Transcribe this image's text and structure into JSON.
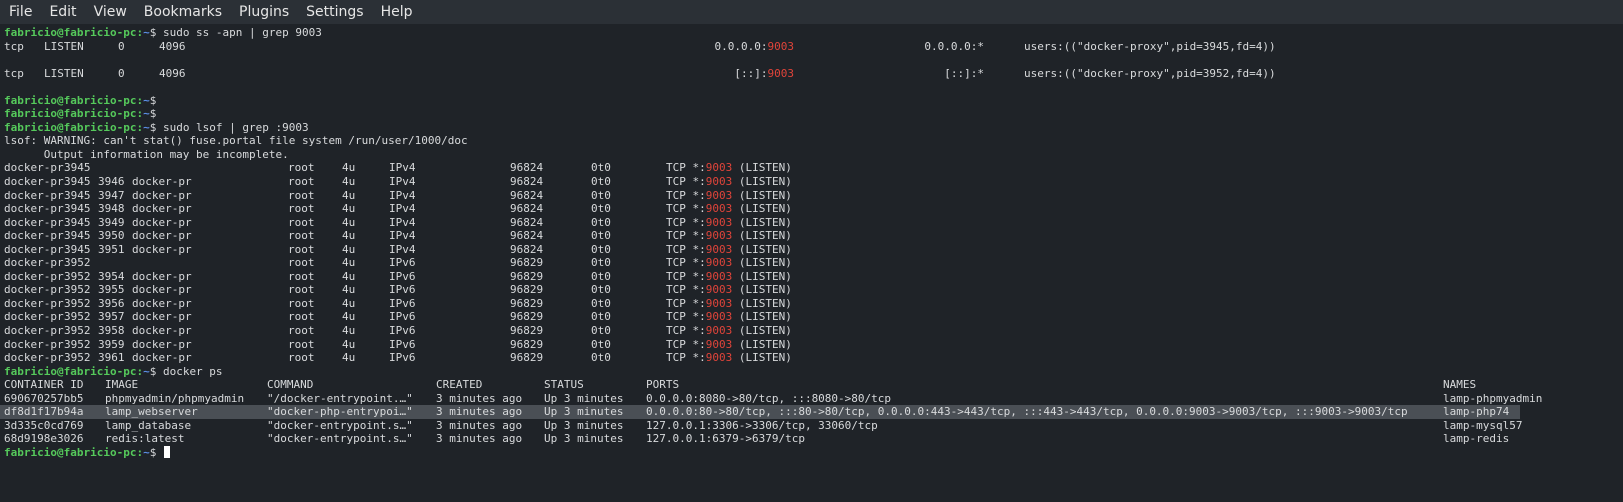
{
  "menu": [
    "File",
    "Edit",
    "View",
    "Bookmarks",
    "Plugins",
    "Settings",
    "Help"
  ],
  "prompt": {
    "user": "fabricio@fabricio-pc",
    "path": "~",
    "symbol": "$"
  },
  "commands": {
    "ss": "sudo ss -apn | grep 9003",
    "lsof": "sudo lsof | grep :9003",
    "dps": "docker ps"
  },
  "ss_rows": [
    {
      "proto": "tcp",
      "state": "LISTEN",
      "recvq": "0",
      "sendq": "4096",
      "local_ip": "0.0.0.0:",
      "port": "9003",
      "peer": "0.0.0.0:*",
      "users": "users:((\"docker-proxy\",pid=3945,fd=4))"
    },
    {
      "proto": "tcp",
      "state": "LISTEN",
      "recvq": "0",
      "sendq": "4096",
      "local_ip": "[::]:",
      "port": "9003",
      "peer": "[::]:*",
      "users": "users:((\"docker-proxy\",pid=3952,fd=4))"
    }
  ],
  "lsof_warning": "lsof: WARNING: can't stat() fuse.portal file system /run/user/1000/doc",
  "lsof_warning2": "      Output information may be incomplete.",
  "lsof_rows": [
    {
      "cmd": "docker-pr",
      "pid": "3945",
      "tid": "",
      "tcmd": "",
      "user": "root",
      "fd": "4u",
      "type": "IPv4",
      "device": "96824",
      "size": "0t0",
      "node": "TCP",
      "name_pre": "*:",
      "port": "9003",
      "state": "(LISTEN)"
    },
    {
      "cmd": "docker-pr",
      "pid": "3945",
      "tid": "3946",
      "tcmd": "docker-pr",
      "user": "root",
      "fd": "4u",
      "type": "IPv4",
      "device": "96824",
      "size": "0t0",
      "node": "TCP",
      "name_pre": "*:",
      "port": "9003",
      "state": "(LISTEN)"
    },
    {
      "cmd": "docker-pr",
      "pid": "3945",
      "tid": "3947",
      "tcmd": "docker-pr",
      "user": "root",
      "fd": "4u",
      "type": "IPv4",
      "device": "96824",
      "size": "0t0",
      "node": "TCP",
      "name_pre": "*:",
      "port": "9003",
      "state": "(LISTEN)"
    },
    {
      "cmd": "docker-pr",
      "pid": "3945",
      "tid": "3948",
      "tcmd": "docker-pr",
      "user": "root",
      "fd": "4u",
      "type": "IPv4",
      "device": "96824",
      "size": "0t0",
      "node": "TCP",
      "name_pre": "*:",
      "port": "9003",
      "state": "(LISTEN)"
    },
    {
      "cmd": "docker-pr",
      "pid": "3945",
      "tid": "3949",
      "tcmd": "docker-pr",
      "user": "root",
      "fd": "4u",
      "type": "IPv4",
      "device": "96824",
      "size": "0t0",
      "node": "TCP",
      "name_pre": "*:",
      "port": "9003",
      "state": "(LISTEN)"
    },
    {
      "cmd": "docker-pr",
      "pid": "3945",
      "tid": "3950",
      "tcmd": "docker-pr",
      "user": "root",
      "fd": "4u",
      "type": "IPv4",
      "device": "96824",
      "size": "0t0",
      "node": "TCP",
      "name_pre": "*:",
      "port": "9003",
      "state": "(LISTEN)"
    },
    {
      "cmd": "docker-pr",
      "pid": "3945",
      "tid": "3951",
      "tcmd": "docker-pr",
      "user": "root",
      "fd": "4u",
      "type": "IPv4",
      "device": "96824",
      "size": "0t0",
      "node": "TCP",
      "name_pre": "*:",
      "port": "9003",
      "state": "(LISTEN)"
    },
    {
      "cmd": "docker-pr",
      "pid": "3952",
      "tid": "",
      "tcmd": "",
      "user": "root",
      "fd": "4u",
      "type": "IPv6",
      "device": "96829",
      "size": "0t0",
      "node": "TCP",
      "name_pre": "*:",
      "port": "9003",
      "state": "(LISTEN)"
    },
    {
      "cmd": "docker-pr",
      "pid": "3952",
      "tid": "3954",
      "tcmd": "docker-pr",
      "user": "root",
      "fd": "4u",
      "type": "IPv6",
      "device": "96829",
      "size": "0t0",
      "node": "TCP",
      "name_pre": "*:",
      "port": "9003",
      "state": "(LISTEN)"
    },
    {
      "cmd": "docker-pr",
      "pid": "3952",
      "tid": "3955",
      "tcmd": "docker-pr",
      "user": "root",
      "fd": "4u",
      "type": "IPv6",
      "device": "96829",
      "size": "0t0",
      "node": "TCP",
      "name_pre": "*:",
      "port": "9003",
      "state": "(LISTEN)"
    },
    {
      "cmd": "docker-pr",
      "pid": "3952",
      "tid": "3956",
      "tcmd": "docker-pr",
      "user": "root",
      "fd": "4u",
      "type": "IPv6",
      "device": "96829",
      "size": "0t0",
      "node": "TCP",
      "name_pre": "*:",
      "port": "9003",
      "state": "(LISTEN)"
    },
    {
      "cmd": "docker-pr",
      "pid": "3952",
      "tid": "3957",
      "tcmd": "docker-pr",
      "user": "root",
      "fd": "4u",
      "type": "IPv6",
      "device": "96829",
      "size": "0t0",
      "node": "TCP",
      "name_pre": "*:",
      "port": "9003",
      "state": "(LISTEN)"
    },
    {
      "cmd": "docker-pr",
      "pid": "3952",
      "tid": "3958",
      "tcmd": "docker-pr",
      "user": "root",
      "fd": "4u",
      "type": "IPv6",
      "device": "96829",
      "size": "0t0",
      "node": "TCP",
      "name_pre": "*:",
      "port": "9003",
      "state": "(LISTEN)"
    },
    {
      "cmd": "docker-pr",
      "pid": "3952",
      "tid": "3959",
      "tcmd": "docker-pr",
      "user": "root",
      "fd": "4u",
      "type": "IPv6",
      "device": "96829",
      "size": "0t0",
      "node": "TCP",
      "name_pre": "*:",
      "port": "9003",
      "state": "(LISTEN)"
    },
    {
      "cmd": "docker-pr",
      "pid": "3952",
      "tid": "3961",
      "tcmd": "docker-pr",
      "user": "root",
      "fd": "4u",
      "type": "IPv6",
      "device": "96829",
      "size": "0t0",
      "node": "TCP",
      "name_pre": "*:",
      "port": "9003",
      "state": "(LISTEN)"
    }
  ],
  "docker": {
    "headers": {
      "id": "CONTAINER ID",
      "image": "IMAGE",
      "command": "COMMAND",
      "created": "CREATED",
      "status": "STATUS",
      "ports": "PORTS",
      "names": "NAMES"
    },
    "rows": [
      {
        "id": "690670257bb5",
        "image": "phpmyadmin/phpmyadmin",
        "command": "\"/docker-entrypoint.…\"",
        "created": "3 minutes ago",
        "status": "Up 3 minutes",
        "ports": "0.0.0.0:8080->80/tcp, :::8080->80/tcp",
        "names": "lamp-phpmyadmin",
        "highlight": false
      },
      {
        "id": "df8d1f17b94a",
        "image": "lamp_webserver",
        "command": "\"docker-php-entrypoi…\"",
        "created": "3 minutes ago",
        "status": "Up 3 minutes",
        "ports": "0.0.0.0:80->80/tcp, :::80->80/tcp, 0.0.0.0:443->443/tcp, :::443->443/tcp, 0.0.0.0:9003->9003/tcp, :::9003->9003/tcp",
        "names": "lamp-php74",
        "highlight": true
      },
      {
        "id": "3d335c0cd769",
        "image": "lamp_database",
        "command": "\"docker-entrypoint.s…\"",
        "created": "3 minutes ago",
        "status": "Up 3 minutes",
        "ports": "127.0.0.1:3306->3306/tcp, 33060/tcp",
        "names": "lamp-mysql57",
        "highlight": false
      },
      {
        "id": "68d9198e3026",
        "image": "redis:latest",
        "command": "\"docker-entrypoint.s…\"",
        "created": "3 minutes ago",
        "status": "Up 3 minutes",
        "ports": "127.0.0.1:6379->6379/tcp",
        "names": "lamp-redis",
        "highlight": false
      }
    ]
  }
}
